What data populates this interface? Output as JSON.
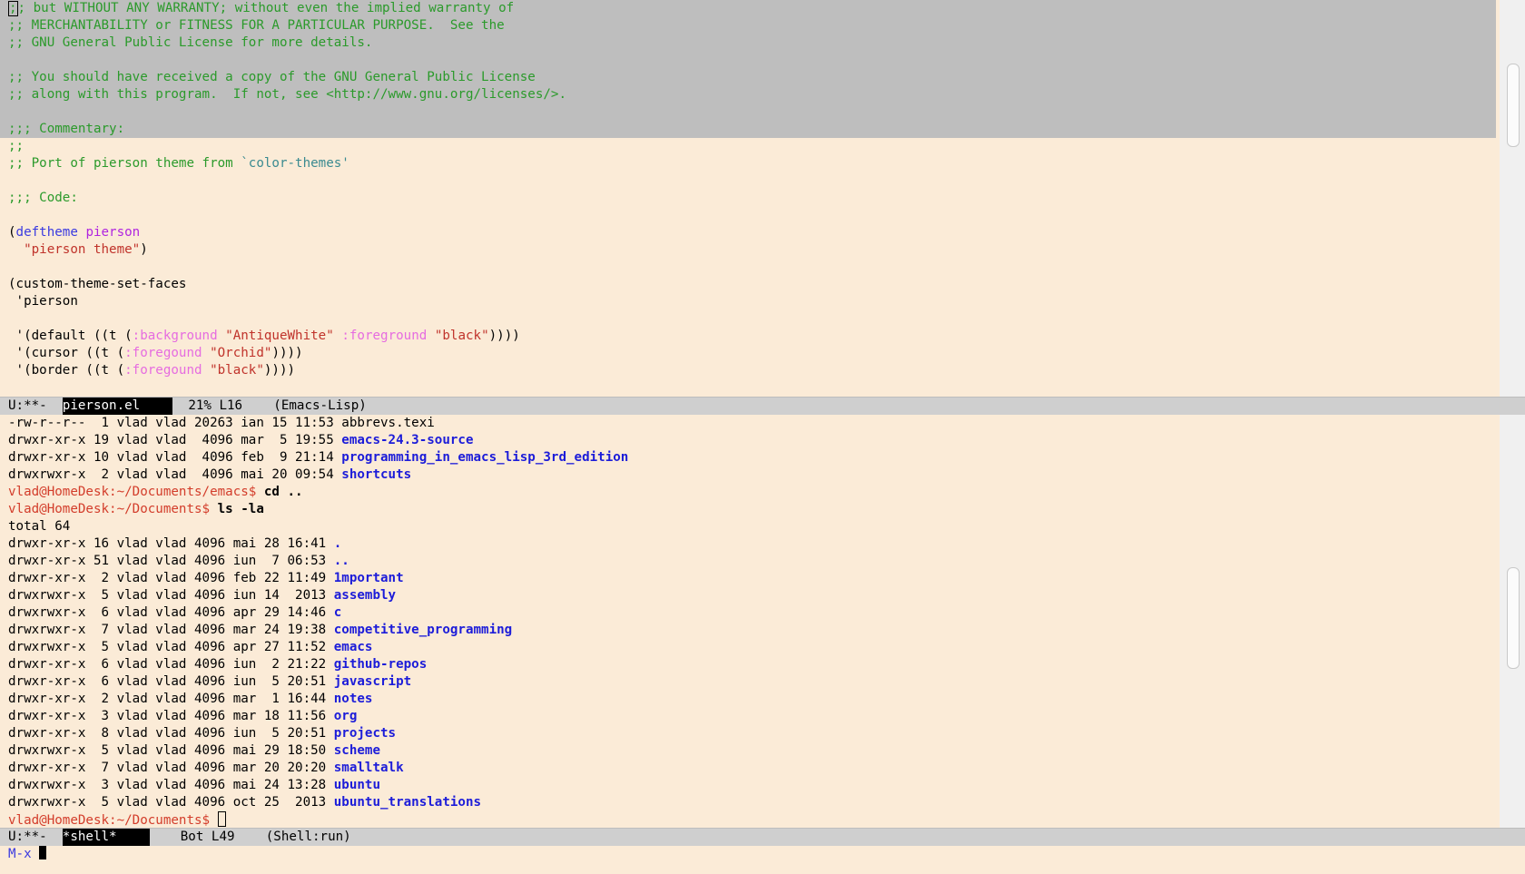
{
  "editor": {
    "lines": [
      {
        "text": ";; but WITHOUT ANY WARRANTY; without even the implied warranty of",
        "sel": true
      },
      {
        "text": ";; MERCHANTABILITY or FITNESS FOR A PARTICULAR PURPOSE.  See the",
        "sel": true
      },
      {
        "text": ";; GNU General Public License for more details.",
        "sel": true
      },
      {
        "text": "",
        "sel": true
      },
      {
        "text": ";; You should have received a copy of the GNU General Public License",
        "sel": true
      },
      {
        "text": ";; along with this program.  If not, see <http://www.gnu.org/licenses/>.",
        "sel": true
      },
      {
        "text": "",
        "sel": true
      },
      {
        "text": ";;; Commentary:",
        "sel": true
      },
      {
        "text": ";;",
        "sel": false
      },
      {
        "text": ";; Port of pierson theme from ",
        "ref": "`color-themes'",
        "sel": false
      },
      {
        "text": "",
        "sel": false
      },
      {
        "text": ";;; Code:",
        "sel": false
      },
      {
        "text": "",
        "sel": false
      },
      {
        "deftheme": true,
        "kw": "deftheme",
        "name": "pierson"
      },
      {
        "docstring": "\"pierson theme\"",
        "close": ")"
      },
      {
        "text": "",
        "sel": false
      },
      {
        "plain": "(custom-theme-set-faces"
      },
      {
        "plain": " 'pierson"
      },
      {
        "text": "",
        "sel": false
      },
      {
        "face": true,
        "prefix": " '(default ((t (",
        "k1": ":background",
        "v1": "\"AntiqueWhite\"",
        "k2": ":foreground",
        "v2": "\"black\"",
        "suffix": "))))"
      },
      {
        "face": true,
        "prefix": " '(cursor ((t (",
        "k1": ":foregound",
        "v1": "\"Orchid\"",
        "suffix": "))))"
      },
      {
        "face": true,
        "prefix": " '(border ((t (",
        "k1": ":foregound",
        "v1": "\"black\"",
        "suffix": "))))"
      }
    ]
  },
  "modeline1": {
    "status": "U:**-  ",
    "buffer": "pierson.el",
    "position": "21% L16",
    "mode": "(Emacs-Lisp)"
  },
  "shell": {
    "lines": [
      {
        "perm": "-rw-r--r--  1 vlad vlad 20263 ian 15 11:53 ",
        "name": "abbrevs.texi",
        "dir": false
      },
      {
        "perm": "drwxr-xr-x 19 vlad vlad  4096 mar  5 19:55 ",
        "name": "emacs-24.3-source",
        "dir": true
      },
      {
        "perm": "drwxr-xr-x 10 vlad vlad  4096 feb  9 21:14 ",
        "name": "programming_in_emacs_lisp_3rd_edition",
        "dir": true
      },
      {
        "perm": "drwxrwxr-x  2 vlad vlad  4096 mai 20 09:54 ",
        "name": "shortcuts",
        "dir": true
      },
      {
        "prompt": "vlad@HomeDesk:~/Documents/emacs$ ",
        "cmd": "cd .."
      },
      {
        "prompt": "vlad@HomeDesk:~/Documents$ ",
        "cmd": "ls -la"
      },
      {
        "perm": "total 64",
        "name": "",
        "dir": false
      },
      {
        "perm": "drwxr-xr-x 16 vlad vlad 4096 mai 28 16:41 ",
        "name": ".",
        "dir": true
      },
      {
        "perm": "drwxr-xr-x 51 vlad vlad 4096 iun  7 06:53 ",
        "name": "..",
        "dir": true
      },
      {
        "perm": "drwxr-xr-x  2 vlad vlad 4096 feb 22 11:49 ",
        "name": "1mportant",
        "dir": true
      },
      {
        "perm": "drwxrwxr-x  5 vlad vlad 4096 iun 14  2013 ",
        "name": "assembly",
        "dir": true
      },
      {
        "perm": "drwxrwxr-x  6 vlad vlad 4096 apr 29 14:46 ",
        "name": "c",
        "dir": true
      },
      {
        "perm": "drwxrwxr-x  7 vlad vlad 4096 mar 24 19:38 ",
        "name": "competitive_programming",
        "dir": true
      },
      {
        "perm": "drwxrwxr-x  5 vlad vlad 4096 apr 27 11:52 ",
        "name": "emacs",
        "dir": true
      },
      {
        "perm": "drwxr-xr-x  6 vlad vlad 4096 iun  2 21:22 ",
        "name": "github-repos",
        "dir": true
      },
      {
        "perm": "drwxr-xr-x  6 vlad vlad 4096 iun  5 20:51 ",
        "name": "javascript",
        "dir": true
      },
      {
        "perm": "drwxr-xr-x  2 vlad vlad 4096 mar  1 16:44 ",
        "name": "notes",
        "dir": true
      },
      {
        "perm": "drwxr-xr-x  3 vlad vlad 4096 mar 18 11:56 ",
        "name": "org",
        "dir": true
      },
      {
        "perm": "drwxr-xr-x  8 vlad vlad 4096 iun  5 20:51 ",
        "name": "projects",
        "dir": true
      },
      {
        "perm": "drwxrwxr-x  5 vlad vlad 4096 mai 29 18:50 ",
        "name": "scheme",
        "dir": true
      },
      {
        "perm": "drwxr-xr-x  7 vlad vlad 4096 mar 20 20:20 ",
        "name": "smalltalk",
        "dir": true
      },
      {
        "perm": "drwxrwxr-x  3 vlad vlad 4096 mai 24 13:28 ",
        "name": "ubuntu",
        "dir": true
      },
      {
        "perm": "drwxrwxr-x  5 vlad vlad 4096 oct 25  2013 ",
        "name": "ubuntu_translations",
        "dir": true
      },
      {
        "prompt": "vlad@HomeDesk:~/Documents$ ",
        "cmd": "",
        "cursor": true
      }
    ]
  },
  "modeline2": {
    "status": "U:**-  ",
    "buffer": "*shell*",
    "position": "Bot L49",
    "mode": "(Shell:run)"
  },
  "minibuffer": {
    "text": "M-x "
  }
}
